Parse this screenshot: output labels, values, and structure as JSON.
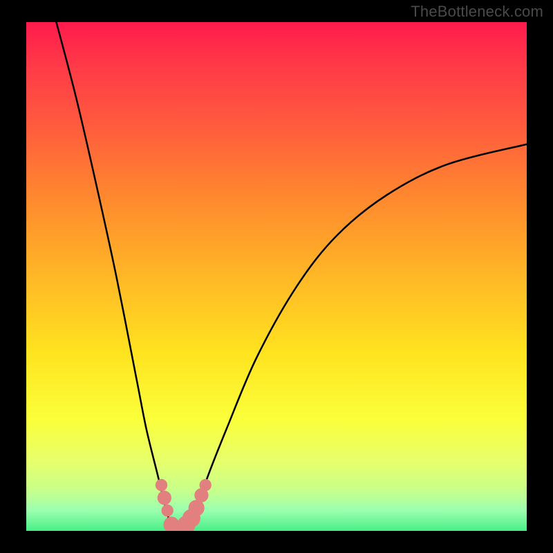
{
  "watermark": "TheBottleneck.com",
  "chart_data": {
    "type": "line",
    "title": "",
    "xlabel": "",
    "ylabel": "",
    "xlim": [
      0,
      100
    ],
    "ylim": [
      0,
      100
    ],
    "series": [
      {
        "name": "bottleneck-curve",
        "x": [
          6,
          10,
          14,
          18,
          22,
          24,
          26,
          27,
          28,
          29,
          30,
          31,
          32,
          34,
          36,
          40,
          46,
          54,
          62,
          72,
          84,
          100
        ],
        "y": [
          100,
          85,
          68,
          50,
          30,
          20,
          12,
          8,
          4,
          1,
          0,
          0,
          1,
          4,
          10,
          20,
          34,
          48,
          58,
          66,
          72,
          76
        ]
      }
    ],
    "markers": {
      "name": "highlight-dots",
      "color": "#e28080",
      "points": [
        {
          "x": 27.0,
          "y": 9.0,
          "r": 1.2
        },
        {
          "x": 27.6,
          "y": 6.5,
          "r": 1.4
        },
        {
          "x": 28.2,
          "y": 4.0,
          "r": 1.2
        },
        {
          "x": 29.0,
          "y": 1.2,
          "r": 1.6
        },
        {
          "x": 30.0,
          "y": 0.5,
          "r": 1.6
        },
        {
          "x": 31.0,
          "y": 0.5,
          "r": 1.6
        },
        {
          "x": 32.0,
          "y": 1.2,
          "r": 1.8
        },
        {
          "x": 33.0,
          "y": 2.5,
          "r": 1.8
        },
        {
          "x": 34.0,
          "y": 4.5,
          "r": 1.6
        },
        {
          "x": 35.0,
          "y": 7.0,
          "r": 1.4
        },
        {
          "x": 35.8,
          "y": 9.0,
          "r": 1.2
        }
      ]
    },
    "gradient_stops": [
      {
        "pos": 0.0,
        "color": "#ff1a4c"
      },
      {
        "pos": 0.08,
        "color": "#ff3848"
      },
      {
        "pos": 0.2,
        "color": "#ff5a3e"
      },
      {
        "pos": 0.35,
        "color": "#ff8a2e"
      },
      {
        "pos": 0.5,
        "color": "#ffb726"
      },
      {
        "pos": 0.65,
        "color": "#ffe31f"
      },
      {
        "pos": 0.78,
        "color": "#faff3a"
      },
      {
        "pos": 0.86,
        "color": "#e8ff6a"
      },
      {
        "pos": 0.92,
        "color": "#c8ff8a"
      },
      {
        "pos": 0.96,
        "color": "#9bffb0"
      },
      {
        "pos": 1.0,
        "color": "#48ef88"
      }
    ]
  }
}
